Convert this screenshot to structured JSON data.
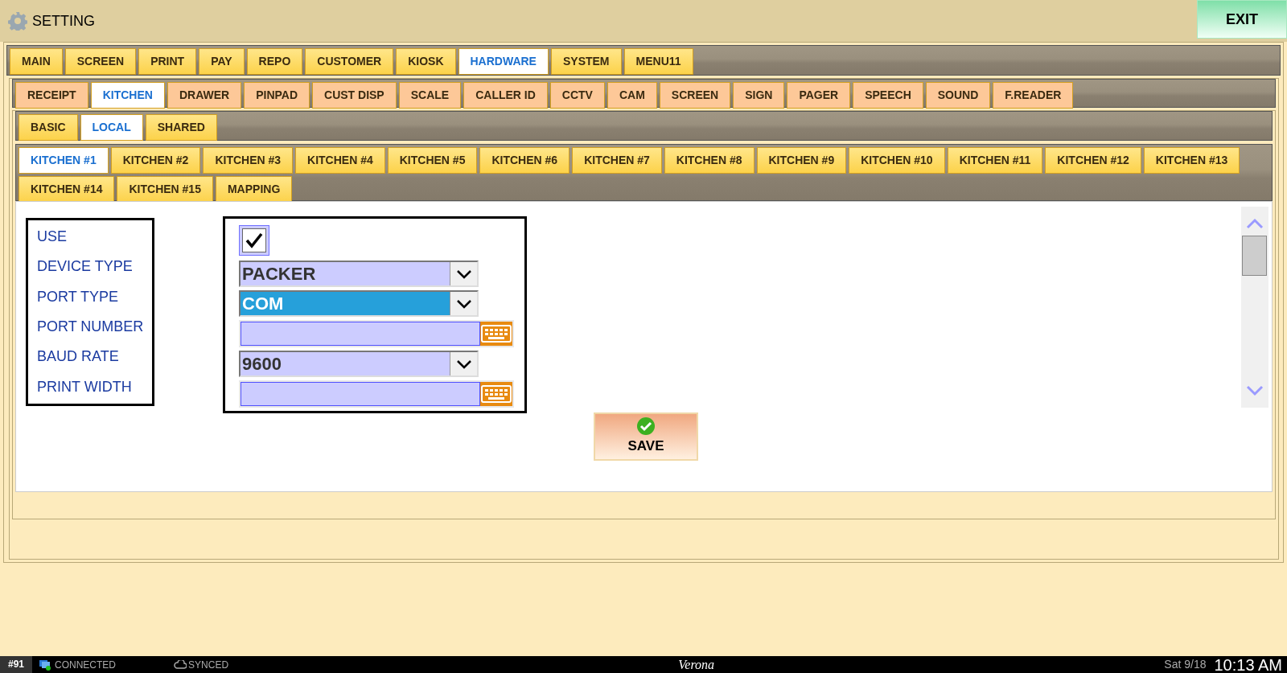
{
  "window": {
    "title": "SETTING",
    "exit_button": "EXIT"
  },
  "main_tabs": [
    {
      "label": "MAIN",
      "selected": false
    },
    {
      "label": "SCREEN",
      "selected": false
    },
    {
      "label": "PRINT",
      "selected": false
    },
    {
      "label": "PAY",
      "selected": false
    },
    {
      "label": "REPO",
      "selected": false
    },
    {
      "label": "CUSTOMER",
      "selected": false
    },
    {
      "label": "KIOSK",
      "selected": false
    },
    {
      "label": "HARDWARE",
      "selected": true
    },
    {
      "label": "SYSTEM",
      "selected": false
    },
    {
      "label": "MENU11",
      "selected": false
    }
  ],
  "hardware_tabs": [
    {
      "label": "RECEIPT",
      "selected": false
    },
    {
      "label": "KITCHEN",
      "selected": true
    },
    {
      "label": "DRAWER",
      "selected": false
    },
    {
      "label": "PINPAD",
      "selected": false
    },
    {
      "label": "CUST DISP",
      "selected": false
    },
    {
      "label": "SCALE",
      "selected": false
    },
    {
      "label": "CALLER ID",
      "selected": false
    },
    {
      "label": "CCTV",
      "selected": false
    },
    {
      "label": "CAM",
      "selected": false
    },
    {
      "label": "SCREEN",
      "selected": false
    },
    {
      "label": "SIGN",
      "selected": false
    },
    {
      "label": "PAGER",
      "selected": false
    },
    {
      "label": "SPEECH",
      "selected": false
    },
    {
      "label": "SOUND",
      "selected": false
    },
    {
      "label": "F.READER",
      "selected": false
    }
  ],
  "kitchen_tabs": [
    {
      "label": "BASIC",
      "selected": false
    },
    {
      "label": "LOCAL",
      "selected": true
    },
    {
      "label": "SHARED",
      "selected": false
    }
  ],
  "printer_tabs": [
    {
      "label": "KITCHEN #1",
      "selected": true
    },
    {
      "label": "KITCHEN #2",
      "selected": false
    },
    {
      "label": "KITCHEN #3",
      "selected": false
    },
    {
      "label": "KITCHEN #4",
      "selected": false
    },
    {
      "label": "KITCHEN #5",
      "selected": false
    },
    {
      "label": "KITCHEN #6",
      "selected": false
    },
    {
      "label": "KITCHEN #7",
      "selected": false
    },
    {
      "label": "KITCHEN #8",
      "selected": false
    },
    {
      "label": "KITCHEN #9",
      "selected": false
    },
    {
      "label": "KITCHEN #10",
      "selected": false
    },
    {
      "label": "KITCHEN #11",
      "selected": false
    },
    {
      "label": "KITCHEN #12",
      "selected": false
    },
    {
      "label": "KITCHEN #13",
      "selected": false
    },
    {
      "label": "KITCHEN #14",
      "selected": false
    },
    {
      "label": "KITCHEN #15",
      "selected": false
    },
    {
      "label": "MAPPING",
      "selected": false
    }
  ],
  "settings": [
    {
      "label": "USE",
      "kind": "checkbox",
      "checked": true
    },
    {
      "label": "DEVICE TYPE",
      "kind": "dropdown",
      "value": "PACKER",
      "selected": false
    },
    {
      "label": "PORT TYPE",
      "kind": "dropdown",
      "value": "COM",
      "selected": true
    },
    {
      "label": "PORT NUMBER",
      "kind": "text"
    },
    {
      "label": "BAUD RATE",
      "kind": "dropdown",
      "value": "9600",
      "selected": false
    },
    {
      "label": "PRINT WIDTH",
      "kind": "text"
    }
  ],
  "save_button": "SAVE",
  "status_bar": {
    "station": "#91",
    "connection": "CONNECTED",
    "sync": "SYNCED",
    "store": "Verona",
    "date": "Sat 9/18",
    "time": "10:13 AM"
  }
}
